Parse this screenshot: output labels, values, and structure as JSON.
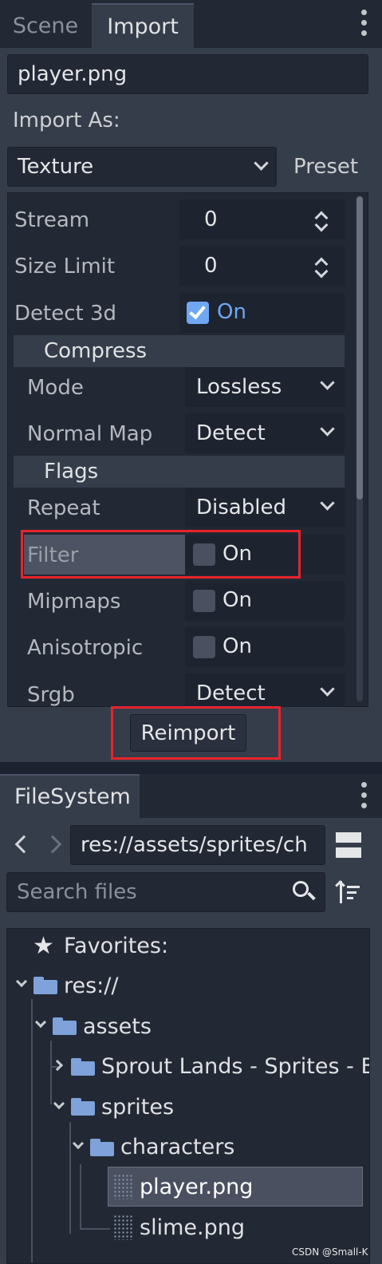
{
  "import_dock": {
    "tabs": [
      {
        "label": "Scene",
        "active": false
      },
      {
        "label": "Import",
        "active": true
      }
    ],
    "file_name": "player.png",
    "import_as_label": "Import As:",
    "import_as_value": "Texture",
    "preset_label": "Preset",
    "properties": {
      "stream": {
        "label": "Stream",
        "value": "0"
      },
      "size_limit": {
        "label": "Size Limit",
        "value": "0"
      },
      "detect_3d": {
        "label": "Detect 3d",
        "value": "On",
        "checked": true
      }
    },
    "compress": {
      "header": "Compress",
      "mode": {
        "label": "Mode",
        "value": "Lossless"
      },
      "normal_map": {
        "label": "Normal Map",
        "value": "Detect"
      }
    },
    "flags": {
      "header": "Flags",
      "repeat": {
        "label": "Repeat",
        "value": "Disabled"
      },
      "filter": {
        "label": "Filter",
        "value": "On",
        "checked": false
      },
      "mipmaps": {
        "label": "Mipmaps",
        "value": "On",
        "checked": false
      },
      "anisotropic": {
        "label": "Anisotropic",
        "value": "On",
        "checked": false
      },
      "srgb": {
        "label": "Srgb",
        "value": "Detect"
      }
    },
    "reimport_label": "Reimport"
  },
  "filesystem_dock": {
    "tab_label": "FileSystem",
    "path": "res://assets/sprites/ch",
    "search_placeholder": "Search files",
    "tree": {
      "favorites": "Favorites:",
      "root": "res://",
      "assets": "assets",
      "sprout_lands": "Sprout Lands - Sprites - B",
      "sprites": "sprites",
      "characters": "characters",
      "player": "player.png",
      "slime": "slime.png"
    }
  },
  "watermark": "CSDN @Small-K",
  "colors": {
    "accent_blue": "#6fa7f2",
    "highlight_red": "#e8232b",
    "panel_bg": "#363d4a",
    "field_bg": "#232835",
    "folder_blue": "#7ea2d9"
  },
  "icons": [
    "kebab-menu-icon",
    "chevron-down-icon",
    "spinner-icon",
    "checkbox-icon",
    "back-arrow-icon",
    "forward-arrow-icon",
    "split-view-icon",
    "search-icon",
    "sort-icon",
    "star-icon",
    "folder-icon",
    "png-thumbnail-icon"
  ]
}
